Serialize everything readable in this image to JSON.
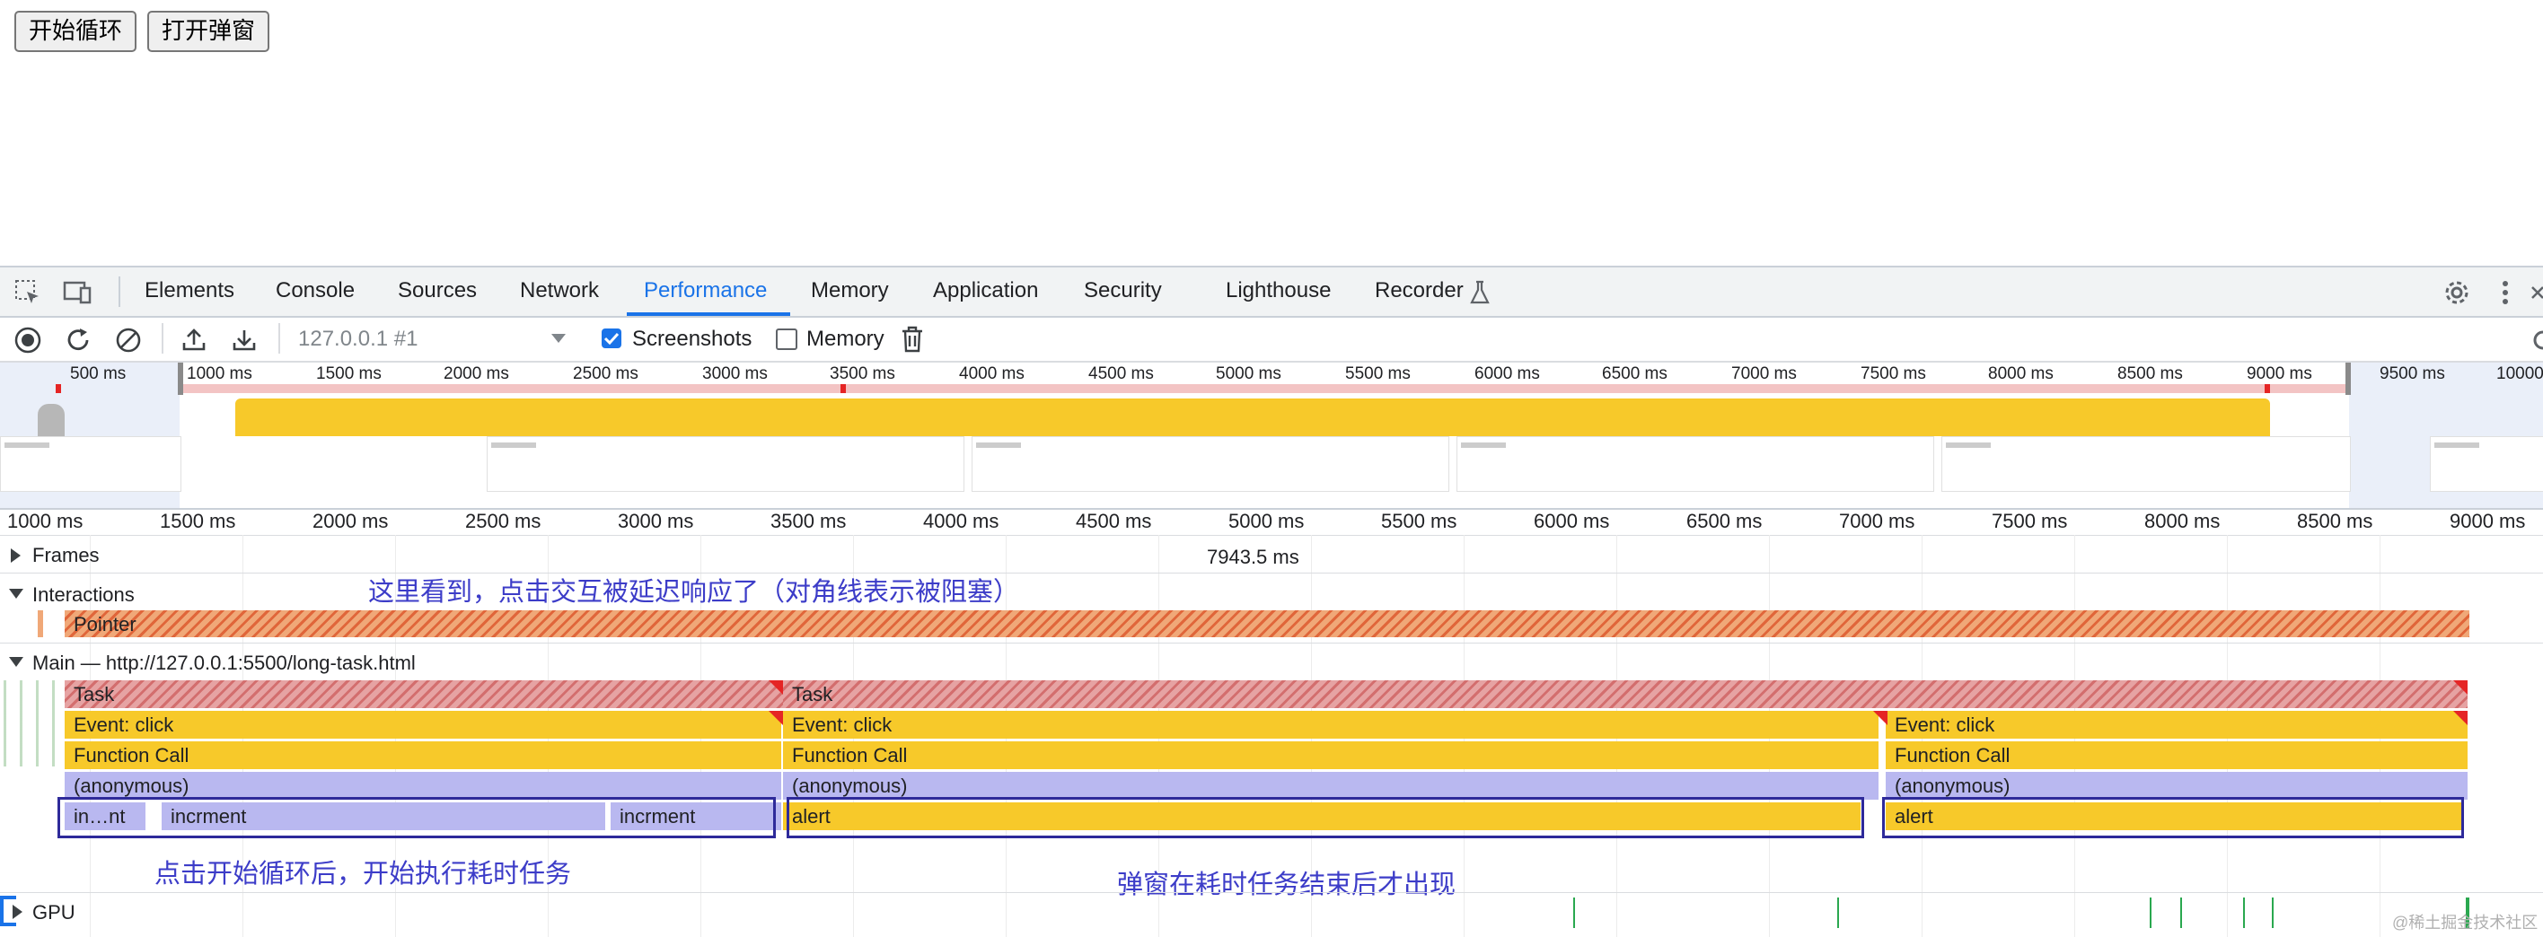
{
  "page": {
    "buttons": [
      "开始循环",
      "打开弹窗"
    ]
  },
  "devtools": {
    "tabs": [
      "Elements",
      "Console",
      "Sources",
      "Network",
      "Performance",
      "Memory",
      "Application",
      "Security",
      "Lighthouse",
      "Recorder"
    ],
    "active_tab": "Performance",
    "recording_select": "127.0.0.1 #1",
    "screenshots_label": "Screenshots",
    "screenshots_checked": true,
    "memory_label": "Memory",
    "memory_checked": false
  },
  "overview": {
    "ticks": [
      "500 ms",
      "1000 ms",
      "1500 ms",
      "2000 ms",
      "2500 ms",
      "3000 ms",
      "3500 ms",
      "4000 ms",
      "4500 ms",
      "5000 ms",
      "5500 ms",
      "6000 ms",
      "6500 ms",
      "7000 ms",
      "7500 ms",
      "8000 ms",
      "8500 ms",
      "9000 ms",
      "9500 ms",
      "10000"
    ],
    "thumb_text": "开始循环 打开弹窗"
  },
  "ruler": {
    "ticks": [
      "1000 ms",
      "1500 ms",
      "2000 ms",
      "2500 ms",
      "3000 ms",
      "3500 ms",
      "4000 ms",
      "4500 ms",
      "5000 ms",
      "5500 ms",
      "6000 ms",
      "6500 ms",
      "7000 ms",
      "7500 ms",
      "8000 ms",
      "8500 ms",
      "9000 ms"
    ]
  },
  "tracks": {
    "frames_label": "Frames",
    "frames_value": "7943.5 ms",
    "interactions_label": "Interactions",
    "pointer_label": "Pointer",
    "main_label": "Main — http://127.0.0.1:5500/long-task.html",
    "gpu_label": "GPU",
    "flame": {
      "task": "Task",
      "event_click": "Event: click",
      "function_call": "Function Call",
      "anonymous": "(anonymous)",
      "in_nt": "in…nt",
      "incrment": "incrment",
      "alert": "alert"
    }
  },
  "annotations": {
    "interaction_note": "这里看到，点击交互被延迟响应了（对角线表示被阻塞）",
    "loop_note": "点击开始循环后，开始执行耗时任务",
    "alert_note": "弹窗在耗时任务结束后才出现"
  },
  "watermark": "@稀土掘金技术社区",
  "colors": {
    "accent": "#1a73e8",
    "task_bar": "#f7c92a",
    "lavender": "#b9b8f0",
    "pointer": "#e0663a",
    "annotation": "#3c3cc8"
  }
}
